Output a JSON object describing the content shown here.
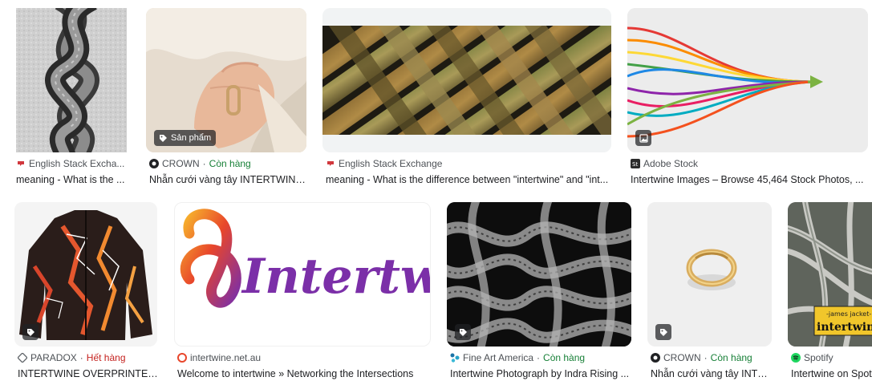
{
  "colors": {
    "in_stock": "#188038",
    "out_of_stock": "#c5221f",
    "text": "#202124",
    "source": "#4d5156"
  },
  "results": [
    {
      "source": "English Stack Excha...",
      "title": "meaning - What is the ...",
      "favicon": "stackexchange-icon"
    },
    {
      "source": "CROWN",
      "stock": "Còn hàng",
      "title": "Nhẫn cưới vàng tây INTERTWINE ...",
      "badge": "Sản phẩm",
      "favicon": "crown-icon"
    },
    {
      "source": "English Stack Exchange",
      "title": "meaning - What is the difference between \"intertwine\" and \"int...",
      "favicon": "stackexchange-icon"
    },
    {
      "source": "Adobe Stock",
      "title": "Intertwine Images – Browse 45,464 Stock Photos, ...",
      "badge_icon": "image-icon",
      "favicon": "adobe-stock-icon"
    },
    {
      "source": "PARADOX",
      "stock": "Hết hàng",
      "title": "INTERTWINE OVERPRINTED ...",
      "badge_icon": "tag-icon",
      "favicon": "paradox-icon"
    },
    {
      "source": "intertwine.net.au",
      "title": "Welcome to intertwine » Networking the Intersections",
      "logo_text": "Intertwine",
      "favicon": "intertwine-icon"
    },
    {
      "source": "Fine Art America",
      "stock": "Còn hàng",
      "title": "Intertwine Photograph by Indra Rising ...",
      "badge_icon": "tag-icon",
      "favicon": "fineart-icon"
    },
    {
      "source": "CROWN",
      "stock": "Còn hàng",
      "title": "Nhẫn cưới vàng tây INTE...",
      "badge_icon": "tag-icon",
      "favicon": "crown-icon"
    },
    {
      "source": "Spotify",
      "title": "Intertwine on Spot",
      "sign_small": "-james jacket-",
      "sign_big": "intertwin",
      "favicon": "spotify-icon"
    }
  ]
}
